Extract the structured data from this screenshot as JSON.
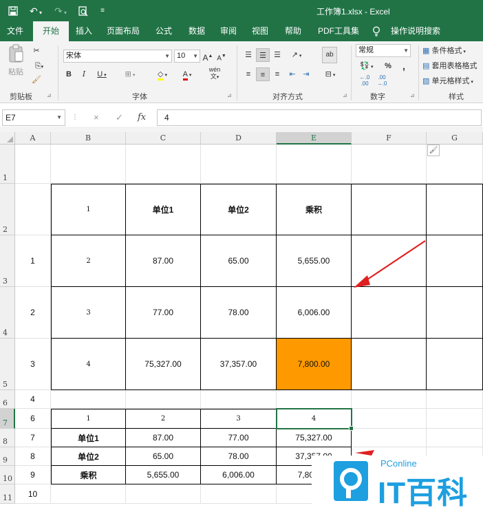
{
  "window": {
    "title": "工作簿1.xlsx  -  Excel"
  },
  "quick_access": {
    "save_icon": "save-icon",
    "undo_icon": "undo-icon",
    "redo_icon": "redo-icon",
    "print_preview_icon": "print-preview-icon",
    "customize_icon": "customize-icon"
  },
  "tabs": [
    {
      "label": "文件"
    },
    {
      "label": "开始"
    },
    {
      "label": "插入"
    },
    {
      "label": "页面布局"
    },
    {
      "label": "公式"
    },
    {
      "label": "数据"
    },
    {
      "label": "审阅"
    },
    {
      "label": "视图"
    },
    {
      "label": "帮助"
    },
    {
      "label": "PDF工具集"
    },
    {
      "label": "操作说明搜索"
    }
  ],
  "ribbon": {
    "clipboard": {
      "paste_label": "粘贴",
      "group_label": "剪贴板"
    },
    "font": {
      "font_name": "宋体",
      "font_size": "10",
      "group_label": "字体",
      "phonetic_label": "wén"
    },
    "alignment": {
      "group_label": "对齐方式",
      "wrap_label": "ab"
    },
    "number": {
      "format": "常规",
      "percent": "%",
      "comma": ",",
      "group_label": "数字"
    },
    "styles": {
      "conditional": "条件格式",
      "table_format": "套用表格格式",
      "cell_styles": "单元格样式",
      "group_label": "样式"
    }
  },
  "formula_bar": {
    "name_box": "E7",
    "cancel": "×",
    "enter": "✓",
    "fx": "fx",
    "value": "4"
  },
  "columns": [
    "A",
    "B",
    "C",
    "D",
    "E",
    "F",
    "G"
  ],
  "rows": [
    "1",
    "2",
    "3",
    "4",
    "5",
    "6",
    "7",
    "8",
    "9",
    "10",
    "11"
  ],
  "cells": {
    "r2": {
      "B": "1",
      "C": "单位1",
      "D": "单位2",
      "E": "乘积"
    },
    "r3": {
      "A": "1",
      "B": "2",
      "C": "87.00",
      "D": "65.00",
      "E": "5,655.00"
    },
    "r4": {
      "A": "2",
      "B": "3",
      "C": "77.00",
      "D": "78.00",
      "E": "6,006.00"
    },
    "r5": {
      "A": "3",
      "B": "4",
      "C": "75,327.00",
      "D": "37,357.00",
      "E": "7,800.00"
    },
    "r6": {
      "A": "4"
    },
    "r7": {
      "A": "6",
      "B": "1",
      "C": "2",
      "D": "3",
      "E": "4"
    },
    "r8": {
      "A": "7",
      "B": "单位1",
      "C": "87.00",
      "D": "77.00",
      "E": "75,327.00"
    },
    "r9": {
      "A": "8",
      "B": "单位2",
      "C": "65.00",
      "D": "78.00",
      "E": "37,357.00"
    },
    "r10": {
      "A": "9",
      "B": "乘积",
      "C": "5,655.00",
      "D": "6,006.00",
      "E": "7,800.00"
    },
    "r11": {
      "A": "10"
    }
  },
  "highlight_color": "#ff9900",
  "accent_color": "#217346",
  "annotation_color": "#e02020",
  "watermark": {
    "brand": "PConline",
    "text": "IT百科"
  }
}
